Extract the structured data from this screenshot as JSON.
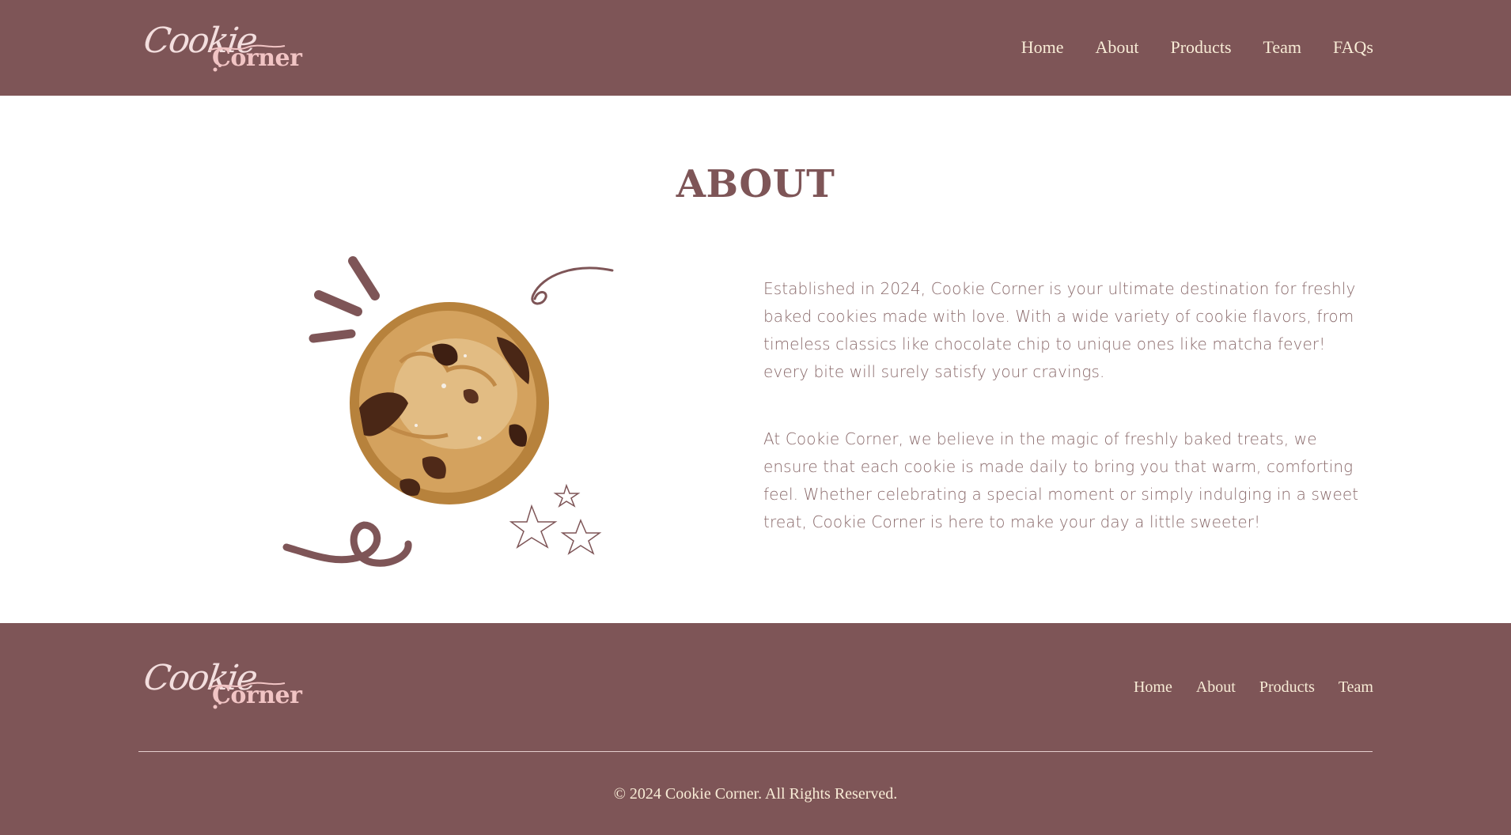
{
  "brand": {
    "logo_script": "Cookie",
    "logo_bold": "Corner"
  },
  "header": {
    "nav": [
      "Home",
      "About",
      "Products",
      "Team",
      "FAQs"
    ]
  },
  "main": {
    "title": "ABOUT",
    "paragraphs": [
      "Established in 2024, Cookie Corner is your ultimate destination for freshly baked cookies made with love. With a wide variety of cookie flavors, from timeless classics like chocolate chip to unique ones like matcha fever! every bite will surely satisfy your cravings.",
      "At Cookie Corner, we believe in the magic of freshly baked treats, we ensure that each cookie is made daily to bring you that warm, comforting feel. Whether celebrating a special moment or simply indulging in a sweet treat, Cookie Corner is here to make your day a little sweeter!"
    ],
    "illustration": {
      "icon": "cookie-illustration",
      "decorations": [
        "burst-strokes",
        "curl-stroke",
        "squiggle-stroke",
        "stars"
      ]
    }
  },
  "footer": {
    "nav": [
      "Home",
      "About",
      "Products",
      "Team"
    ],
    "copyright": "© 2024 Cookie Corner. All Rights Reserved."
  },
  "colors": {
    "brand": "#7e5557",
    "nav_text": "#f8ecd6",
    "body_text": "#8a6a6b",
    "logo_accent": "#f1c4c4"
  }
}
